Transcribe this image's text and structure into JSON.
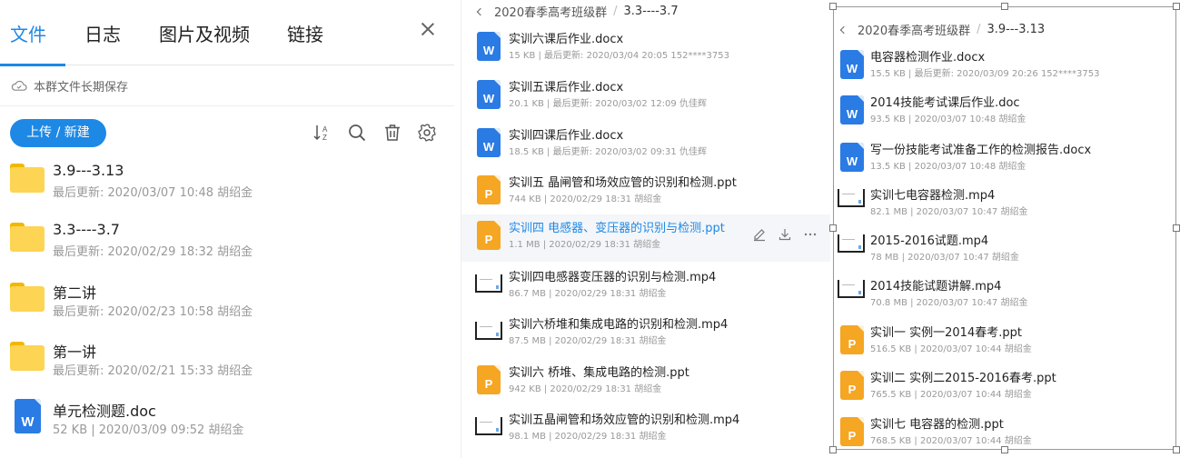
{
  "panel1": {
    "tabs": [
      "文件",
      "日志",
      "图片及视频",
      "链接"
    ],
    "notice": "本群文件长期保存",
    "upload_label": "上传 / 新建",
    "icons": [
      "sort-az-icon",
      "search-icon",
      "trash-icon",
      "gear-icon",
      "close-icon",
      "cloud-icon"
    ],
    "items": [
      {
        "name": "3.9---3.13",
        "meta": "最后更新: 2020/03/07 10:48  胡绍金",
        "type": "folder"
      },
      {
        "name": "3.3----3.7",
        "meta": "最后更新: 2020/02/29 18:32  胡绍金",
        "type": "folder"
      },
      {
        "name": "第二讲",
        "meta": "最后更新: 2020/02/23 10:58  胡绍金",
        "type": "folder"
      },
      {
        "name": "第一讲",
        "meta": "最后更新: 2020/02/21 15:33  胡绍金",
        "type": "folder"
      },
      {
        "name": "单元检测题.doc",
        "meta": "52 KB  |  2020/03/09 09:52  胡绍金",
        "type": "word"
      }
    ]
  },
  "panel2": {
    "breadcrumb_root": "2020春季高考班级群",
    "breadcrumb_current": "3.3----3.7",
    "items": [
      {
        "name": "实训六课后作业.docx",
        "meta": "15 KB  |  最后更新: 2020/03/04 20:05  152****3753",
        "type": "word"
      },
      {
        "name": "实训五课后作业.docx",
        "meta": "20.1 KB  |  最后更新: 2020/03/02 12:09  仇佳辉",
        "type": "word"
      },
      {
        "name": "实训四课后作业.docx",
        "meta": "18.5 KB  |  最后更新: 2020/03/02 09:31  仇佳辉",
        "type": "word"
      },
      {
        "name": "实训五 晶闸管和场效应管的识别和检测.ppt",
        "meta": "744 KB  |  2020/02/29 18:31  胡绍金",
        "type": "ppt"
      },
      {
        "name": "实训四 电感器、变压器的识别与检测.ppt",
        "meta": "1.1 MB  |  2020/02/29 18:31  胡绍金",
        "type": "ppt"
      },
      {
        "name": "实训四电感器变压器的识别与检测.mp4",
        "meta": "86.7 MB  |  2020/02/29 18:31  胡绍金",
        "type": "video"
      },
      {
        "name": "实训六桥堆和集成电路的识别和检测.mp4",
        "meta": "87.5 MB  |  2020/02/29 18:31  胡绍金",
        "type": "video"
      },
      {
        "name": "实训六 桥堆、集成电路的检测.ppt",
        "meta": "942 KB  |  2020/02/29 18:31  胡绍金",
        "type": "ppt"
      },
      {
        "name": "实训五晶闸管和场效应管的识别和检测.mp4",
        "meta": "98.1 MB  |  2020/02/29 18:31  胡绍金",
        "type": "video"
      }
    ],
    "row_actions": [
      "edit-icon",
      "download-icon",
      "more-icon"
    ]
  },
  "panel3": {
    "breadcrumb_root": "2020春季高考班级群",
    "breadcrumb_current": "3.9---3.13",
    "items": [
      {
        "name": "电容器检测作业.docx",
        "meta": "15.5 KB  |  最后更新: 2020/03/09 20:26  152****3753",
        "type": "word"
      },
      {
        "name": "2014技能考试课后作业.doc",
        "meta": "93.5 KB  |  2020/03/07 10:48  胡绍金",
        "type": "word"
      },
      {
        "name": "写一份技能考试准备工作的检测报告.docx",
        "meta": "13.5 KB  |  2020/03/07 10:48  胡绍金",
        "type": "word"
      },
      {
        "name": "实训七电容器检测.mp4",
        "meta": "82.1 MB  |  2020/03/07 10:47  胡绍金",
        "type": "video"
      },
      {
        "name": "2015-2016试题.mp4",
        "meta": "78 MB  |  2020/03/07 10:47  胡绍金",
        "type": "video"
      },
      {
        "name": "2014技能试题讲解.mp4",
        "meta": "70.8 MB  |  2020/03/07 10:47  胡绍金",
        "type": "video"
      },
      {
        "name": "实训一 实例一2014春考.ppt",
        "meta": "516.5 KB  |  2020/03/07 10:44  胡绍金",
        "type": "ppt"
      },
      {
        "name": "实训二 实例二2015-2016春考.ppt",
        "meta": "765.5 KB  |  2020/03/07 10:44  胡绍金",
        "type": "ppt"
      },
      {
        "name": "实训七 电容器的检测.ppt",
        "meta": "768.5 KB  |  2020/03/07 10:44  胡绍金",
        "type": "ppt"
      }
    ]
  },
  "colors": {
    "accent": "#1e88e5",
    "word": "#2a7be4",
    "ppt": "#f5a623",
    "folder": "#fdd453"
  },
  "file_icon_letters": {
    "word": "W",
    "ppt": "P"
  }
}
